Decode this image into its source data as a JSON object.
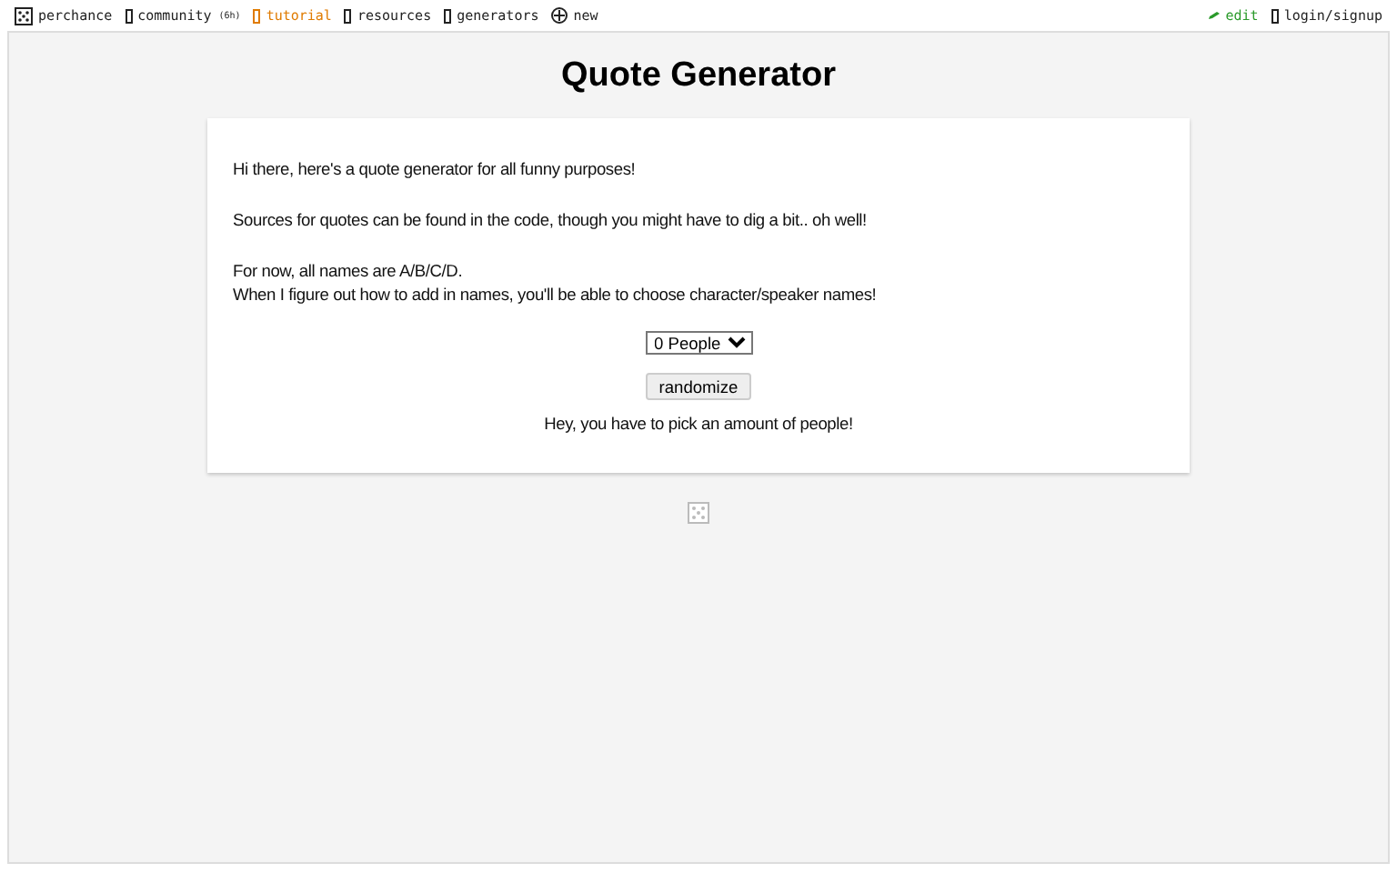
{
  "nav": {
    "left": [
      {
        "kind": "logo",
        "label": "perchance"
      },
      {
        "kind": "box",
        "label": "community",
        "note": "(6h)"
      },
      {
        "kind": "box",
        "label": "tutorial",
        "highlight": true
      },
      {
        "kind": "box",
        "label": "resources"
      },
      {
        "kind": "box",
        "label": "generators"
      },
      {
        "kind": "plus",
        "label": "new"
      }
    ],
    "right": [
      {
        "kind": "pencil",
        "label": "edit"
      },
      {
        "kind": "box",
        "label": "login/signup"
      }
    ]
  },
  "title": "Quote Generator",
  "card": {
    "paragraphs": [
      [
        "Hi there, here's a quote generator for all funny purposes!"
      ],
      [
        "Sources for quotes can be found in the code, though you might have to dig a bit.. oh well!"
      ],
      [
        "For now, all names are A/B/C/D.",
        "When I figure out how to add in names, you'll be able to choose character/speaker names!"
      ]
    ],
    "select": {
      "value": "0 People"
    },
    "button": "randomize",
    "output": "Hey, you have to pick an amount of people!"
  }
}
